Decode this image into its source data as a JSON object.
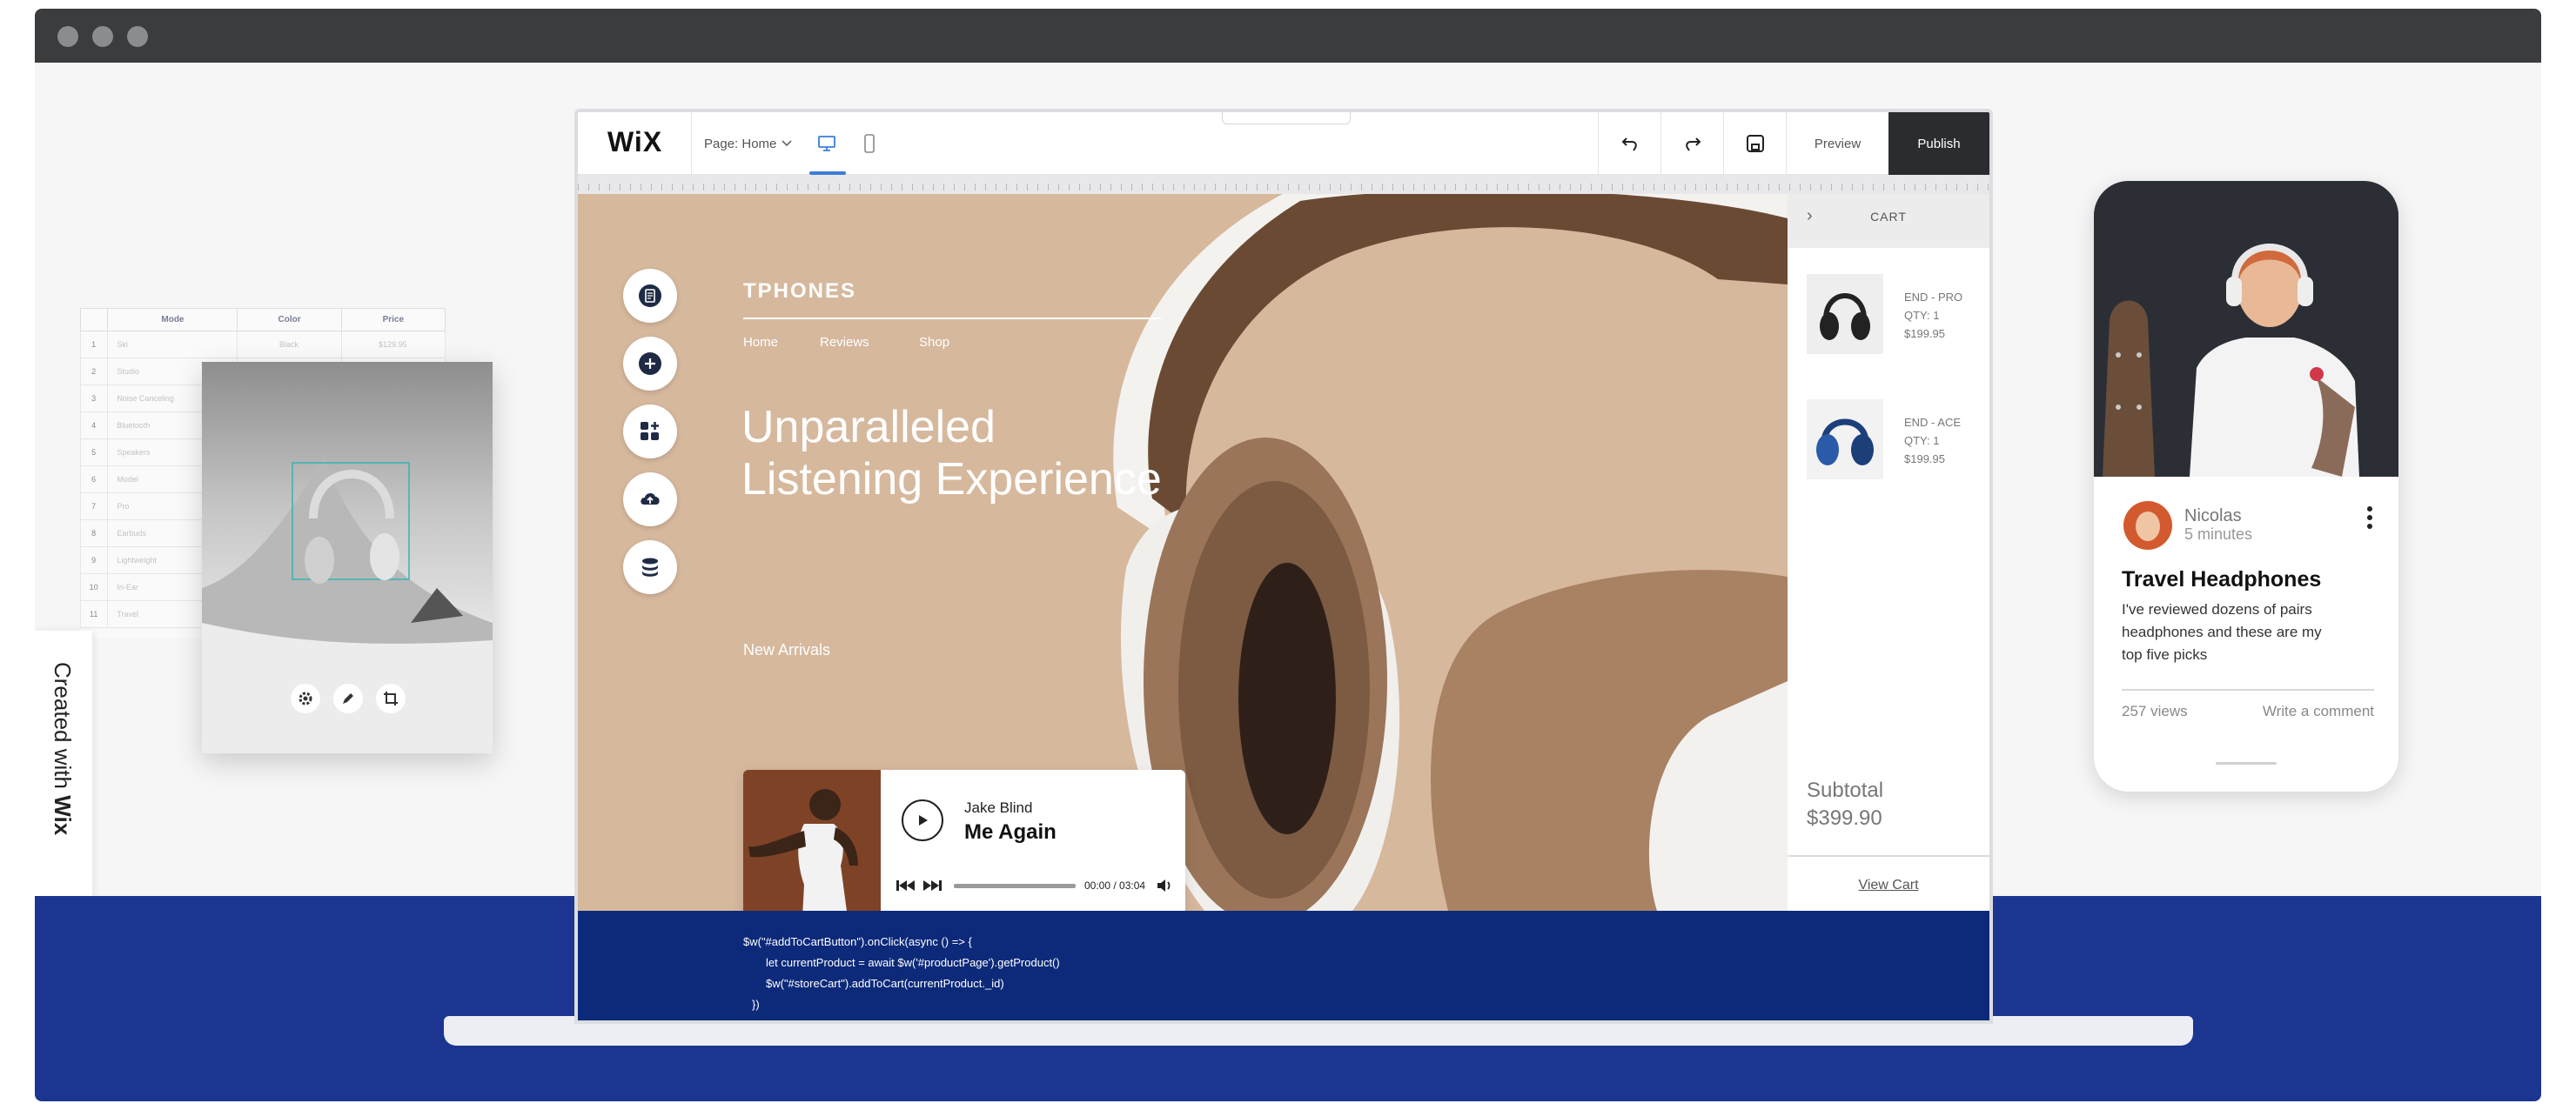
{
  "editor": {
    "logo": "WiX",
    "page_selector": "Page: Home",
    "preview_label": "Preview",
    "publish_label": "Publish"
  },
  "site": {
    "brand": "TPHONES",
    "nav": [
      "Home",
      "Reviews",
      "Shop"
    ],
    "hero_line1": "Unparalleled",
    "hero_line2": "Listening Experience",
    "section_label": "New Arrivals"
  },
  "player": {
    "artist": "Jake Blind",
    "track": "Me Again",
    "time": "00:00 / 03:04",
    "progress": 0
  },
  "cart": {
    "title": "CART",
    "items": [
      {
        "name": "END - PRO",
        "qty": "QTY: 1",
        "price": "$199.95"
      },
      {
        "name": "END - ACE",
        "qty": "QTY: 1",
        "price": "$199.95"
      }
    ],
    "subtotal_label": "Subtotal",
    "subtotal_value": "$399.90",
    "view_cart": "View Cart"
  },
  "code": {
    "line1": "$w(\"#addToCartButton\").onClick(async () => {",
    "line2": "let currentProduct = await $w('#productPage').getProduct()",
    "line3": "$w(\"#storeCart\").addToCart(currentProduct._id)",
    "line4": "})"
  },
  "sheet": {
    "headers": [
      "Mode",
      "Color",
      "Price"
    ],
    "rows": [
      {
        "n": "1",
        "mode": "Ski",
        "color": "Black",
        "price": "$129.95"
      },
      {
        "n": "2",
        "mode": "Studio",
        "color": "",
        "price": ""
      },
      {
        "n": "3",
        "mode": "Noise Canceling",
        "color": "",
        "price": ""
      },
      {
        "n": "4",
        "mode": "Bluetooth",
        "color": "",
        "price": ""
      },
      {
        "n": "5",
        "mode": "Speakers",
        "color": "",
        "price": ""
      },
      {
        "n": "6",
        "mode": "Model",
        "color": "",
        "price": ""
      },
      {
        "n": "7",
        "mode": "Pro",
        "color": "",
        "price": ""
      },
      {
        "n": "8",
        "mode": "Earbuds",
        "color": "",
        "price": ""
      },
      {
        "n": "9",
        "mode": "Lightweight",
        "color": "",
        "price": ""
      },
      {
        "n": "10",
        "mode": "In-Ear",
        "color": "",
        "price": ""
      },
      {
        "n": "11",
        "mode": "Travel",
        "color": "",
        "price": ""
      }
    ]
  },
  "badge": {
    "prefix": "Created with",
    "brand": "Wix"
  },
  "blog": {
    "author": "Nicolas",
    "time": "5 minutes",
    "title": "Travel Headphones",
    "excerpt_line1": "I've reviewed dozens of pairs",
    "excerpt_line2": "headphones and these are my",
    "excerpt_line3": "top five picks",
    "views": "257 views",
    "comment": "Write a comment"
  },
  "colors": {
    "canvas_bg": "#d6b89d",
    "code_bg": "#0d2a7a",
    "footer_blue": "#1b3591",
    "publish_bg": "#2b2c2f",
    "accent_blue": "#3b7dd8"
  },
  "icons": [
    "undo-icon",
    "redo-icon",
    "save-icon",
    "desktop-icon",
    "mobile-icon",
    "chevron-down-icon",
    "pages-icon",
    "add-icon",
    "apps-icon",
    "upload-icon",
    "database-icon",
    "play-icon",
    "prev-icon",
    "next-icon",
    "volume-icon",
    "more-icon",
    "settings-icon",
    "pen-icon",
    "crop-icon"
  ]
}
